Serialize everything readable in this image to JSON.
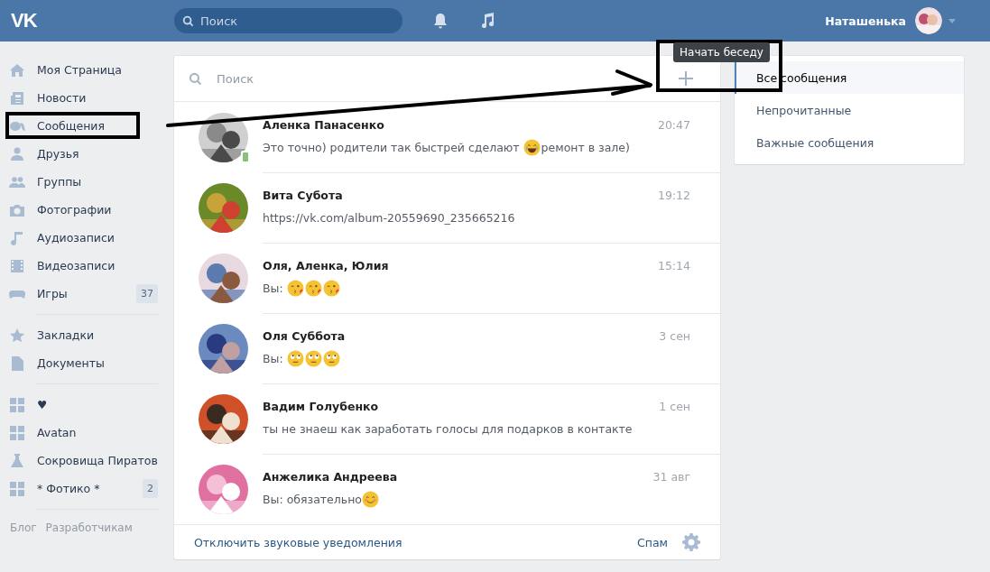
{
  "header": {
    "logo": "VK",
    "search": {
      "placeholder": "Поиск"
    },
    "user_name": "Наташенька"
  },
  "sidebar": {
    "groups": [
      [
        {
          "label": "Моя Страница"
        },
        {
          "label": "Новости"
        },
        {
          "label": "Сообщения"
        },
        {
          "label": "Друзья"
        },
        {
          "label": "Группы"
        },
        {
          "label": "Фотографии"
        },
        {
          "label": "Аудиозаписи"
        },
        {
          "label": "Видеозаписи"
        },
        {
          "label": "Игры",
          "count": "37"
        }
      ],
      [
        {
          "label": "Закладки"
        },
        {
          "label": "Документы"
        }
      ],
      [
        {
          "label": "♥"
        },
        {
          "label": "Avatan"
        },
        {
          "label": "Сокровища Пиратов"
        },
        {
          "label": "* Фотико *",
          "count": "2"
        }
      ]
    ],
    "footer_links": [
      "Блог",
      "Разработчикам"
    ]
  },
  "dialogs": {
    "search": {
      "placeholder": "Поиск"
    },
    "tooltip": "Начать беседу",
    "rows": [
      {
        "name": "Аленка Панасенко",
        "time": "20:47",
        "online_mobile": true,
        "message": [
          {
            "kind": "text",
            "text": "Это точно) родители так быстрей сделают "
          },
          {
            "kind": "laugh"
          },
          {
            "kind": "text",
            "text": "ремонт в зале)"
          }
        ]
      },
      {
        "name": "Вита Субота",
        "time": "19:12",
        "online_mobile": false,
        "message": [
          {
            "kind": "text",
            "text": "https://vk.com/album-20559690_235665216"
          }
        ]
      },
      {
        "name": "Оля, Аленка, Юлия",
        "time": "15:14",
        "online_mobile": false,
        "message": [
          {
            "kind": "text",
            "text": "Вы: "
          },
          {
            "kind": "kiss"
          },
          {
            "kind": "kiss"
          },
          {
            "kind": "kiss"
          }
        ]
      },
      {
        "name": "Оля Суббота",
        "time": "3 сен",
        "online_mobile": false,
        "message": [
          {
            "kind": "text",
            "text": "Вы: "
          },
          {
            "kind": "eyeroll"
          },
          {
            "kind": "eyeroll"
          },
          {
            "kind": "eyeroll"
          }
        ]
      },
      {
        "name": "Вадим Голубенко",
        "time": "1 сен",
        "online_mobile": false,
        "message": [
          {
            "kind": "text",
            "text": "ты не знаеш как заработать голосы для подарков в контакте"
          }
        ]
      },
      {
        "name": "Анжелика Андреева",
        "time": "31 авг",
        "online_mobile": false,
        "message": [
          {
            "kind": "text",
            "text": "Вы: обязательно"
          },
          {
            "kind": "smile"
          }
        ]
      }
    ],
    "footer": {
      "mute_link": "Отключить звуковые уведомления",
      "spam_link": "Спам"
    }
  },
  "filters": [
    {
      "label": "Все сообщения",
      "selected": true
    },
    {
      "label": "Непрочитанные",
      "selected": false
    },
    {
      "label": "Важные сообщения",
      "selected": false
    }
  ]
}
